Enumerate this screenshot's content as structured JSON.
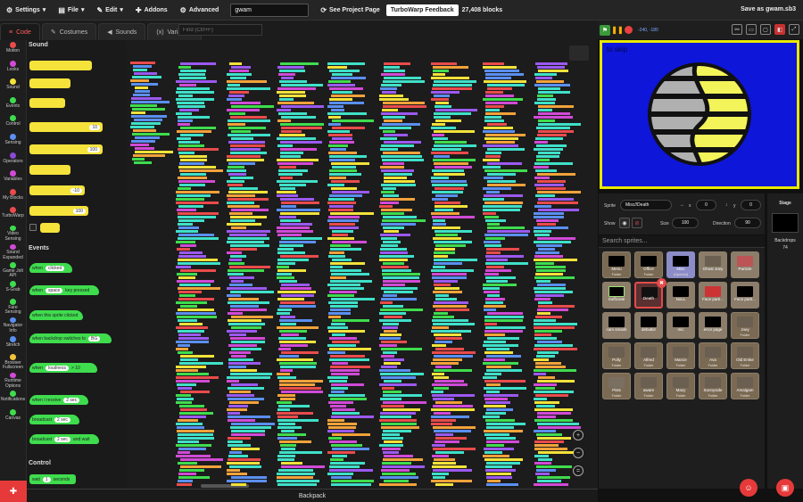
{
  "menubar": {
    "settings": "Settings",
    "file": "File",
    "edit": "Edit",
    "addons": "Addons",
    "advanced": "Advanced",
    "project_title": "gwam",
    "see_project_page": "See Project Page",
    "feedback": "TurboWarp Feedback",
    "blocks_count": "27,408 blocks",
    "save_as": "Save as gwam.sb3"
  },
  "tabs": {
    "code": "Code",
    "costumes": "Costumes",
    "sounds": "Sounds",
    "variables": "Variables",
    "find_placeholder": "Find (Ctrl+F)"
  },
  "categories": [
    {
      "label": "Motion",
      "color": "#e94b4b"
    },
    {
      "label": "Looks",
      "color": "#d04ad6"
    },
    {
      "label": "Sound",
      "color": "#f2e23a"
    },
    {
      "label": "Events",
      "color": "#3fdc4e"
    },
    {
      "label": "Control",
      "color": "#3fdc4e"
    },
    {
      "label": "Sensing",
      "color": "#5a8ff0"
    },
    {
      "label": "Operators",
      "color": "#8a4ad6"
    },
    {
      "label": "Variables",
      "color": "#d04ad6"
    },
    {
      "label": "My Blocks",
      "color": "#e94b4b"
    },
    {
      "label": "TurboWarp",
      "color": "#e94b4b"
    },
    {
      "label": "Video Sensing",
      "color": "#3fdc4e"
    },
    {
      "label": "Sound Expanded",
      "color": "#d04ad6"
    },
    {
      "label": "Game Jolt API",
      "color": "#3fdc4e"
    },
    {
      "label": "S-Grab",
      "color": "#3fdc4e"
    },
    {
      "label": "Fare Sensing",
      "color": "#3fdc4e"
    },
    {
      "label": "Navigator Info",
      "color": "#5a8ff0"
    },
    {
      "label": "Stretch",
      "color": "#5a8ff0"
    },
    {
      "label": "Browser Fullscreen",
      "color": "#f2c23a"
    },
    {
      "label": "Runtime Options",
      "color": "#d04ad6"
    },
    {
      "label": "Notifications",
      "color": "#3fdc4e"
    },
    {
      "label": "Canvas",
      "color": "#3fdc4e"
    }
  ],
  "palette": {
    "sound_heading": "Sound",
    "events_heading": "Events",
    "control_heading": "Control",
    "events_blocks": [
      {
        "text": "when",
        "slot": "clicked"
      },
      {
        "text": "when",
        "slot": "space",
        "text2": "key pressed"
      },
      {
        "text": "when this sprite clicked",
        "slot": ""
      },
      {
        "text": "when backdrop switches to",
        "slot": "BG"
      },
      {
        "text": "when",
        "slot": "loudness",
        "text2": "> 10"
      },
      {
        "text": "when I receive",
        "slot": "2 sec"
      },
      {
        "text": "broadcast",
        "slot": "2 sec"
      },
      {
        "text": "broadcast",
        "slot": "2 sec",
        "text2": "and wait"
      }
    ],
    "control_blocks": [
      {
        "text": "wait",
        "slot": "1",
        "text2": "seconds"
      }
    ],
    "sound_blocks": [
      {
        "slot": "10"
      },
      {
        "slot": "100"
      },
      {
        "slot": "-10"
      },
      {
        "slot": "100"
      }
    ]
  },
  "backpack": "Backpack",
  "stage": {
    "coords": "-240, -180",
    "text": "to skip"
  },
  "sprite_info": {
    "sprite_label": "Sprite",
    "sprite_name": "Misc//Death",
    "x_label": "x",
    "x_value": "0",
    "y_label": "y",
    "y_value": "0",
    "show_label": "Show",
    "size_label": "Size",
    "size_value": "100",
    "direction_label": "Direction",
    "direction_value": "90"
  },
  "search_sprites_placeholder": "Search sprites...",
  "sprites": [
    {
      "name": "Menu",
      "sub": "Folder",
      "kind": "folder"
    },
    {
      "name": "Office",
      "sub": "Folder",
      "kind": "folder"
    },
    {
      "name": "Misc",
      "sub": "(Opened)",
      "kind": "folder"
    },
    {
      "name": "Ghost Joey",
      "sub": "",
      "kind": "sprite"
    },
    {
      "name": "Particle",
      "sub": "",
      "kind": "sprite"
    },
    {
      "name": "Sufficiote",
      "sub": "",
      "kind": "sprite"
    },
    {
      "name": "Death",
      "sub": "",
      "kind": "selected"
    },
    {
      "name": "NuLL",
      "sub": "",
      "kind": "sprite"
    },
    {
      "name": "Face parti...",
      "sub": "",
      "kind": "sprite"
    },
    {
      "name": "Face parti...",
      "sub": "",
      "kind": "sprite"
    },
    {
      "name": "cam smash",
      "sub": "",
      "kind": "sprite"
    },
    {
      "name": "debutkir",
      "sub": "",
      "kind": "sprite"
    },
    {
      "name": "mic",
      "sub": "",
      "kind": "sprite"
    },
    {
      "name": "error page",
      "sub": "",
      "kind": "sprite"
    },
    {
      "name": "Joey",
      "sub": "Folder",
      "kind": "folder"
    },
    {
      "name": "Polly",
      "sub": "Folder",
      "kind": "folder"
    },
    {
      "name": "Alfred",
      "sub": "Folder",
      "kind": "folder"
    },
    {
      "name": "Marcie",
      "sub": "Folder",
      "kind": "folder"
    },
    {
      "name": "Ava",
      "sub": "Folder",
      "kind": "folder"
    },
    {
      "name": "Old Emke",
      "sub": "Folder",
      "kind": "folder"
    },
    {
      "name": "Pists",
      "sub": "Folder",
      "kind": "folder"
    },
    {
      "name": "aware",
      "sub": "Folder",
      "kind": "folder"
    },
    {
      "name": "Maxy",
      "sub": "Folder",
      "kind": "folder"
    },
    {
      "name": "Sunnyside",
      "sub": "Folder",
      "kind": "folder"
    },
    {
      "name": "Amalgam",
      "sub": "Folder",
      "kind": "folder"
    }
  ],
  "stage_target": {
    "stage_label": "Stage",
    "backdrops_label": "Backdrops",
    "backdrops_count": "74"
  }
}
